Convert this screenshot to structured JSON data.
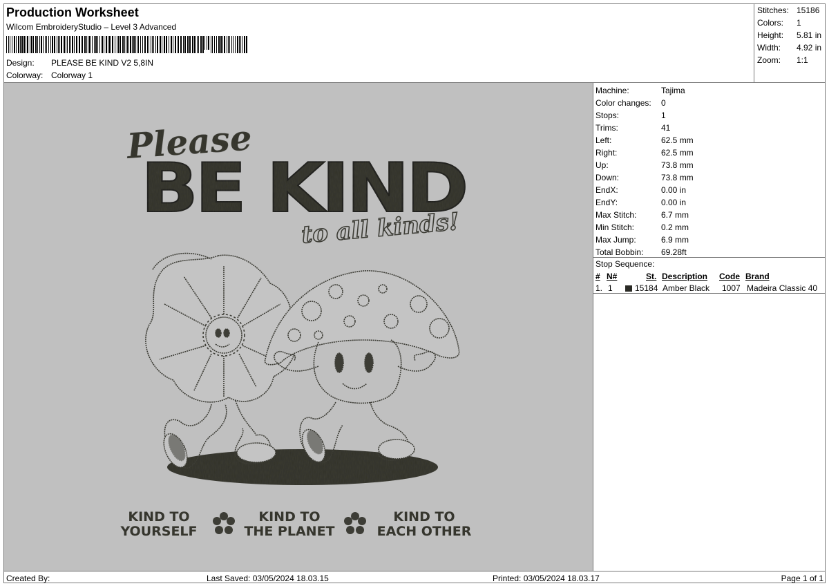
{
  "header": {
    "title": "Production Worksheet",
    "subtitle": "Wilcom EmbroideryStudio – Level 3 Advanced",
    "barcode_icon": "barcode",
    "design_label": "Design:",
    "design_value": "PLEASE BE KIND V2 5,8IN",
    "colorway_label": "Colorway:",
    "colorway_value": "Colorway 1"
  },
  "stats": {
    "stitches_label": "Stitches:",
    "stitches_value": "15186",
    "colors_label": "Colors:",
    "colors_value": "1",
    "height_label": "Height:",
    "height_value": "5.81 in",
    "width_label": "Width:",
    "width_value": "4.92 in",
    "zoom_label": "Zoom:",
    "zoom_value": "1:1"
  },
  "machine_info": [
    {
      "label": "Machine:",
      "value": "Tajima"
    },
    {
      "label": "Color changes:",
      "value": "0"
    },
    {
      "label": "Stops:",
      "value": "1"
    },
    {
      "label": "Trims:",
      "value": "41"
    },
    {
      "label": "Left:",
      "value": "62.5 mm"
    },
    {
      "label": "Right:",
      "value": "62.5 mm"
    },
    {
      "label": "Up:",
      "value": "73.8 mm"
    },
    {
      "label": "Down:",
      "value": "73.8 mm"
    },
    {
      "label": "EndX:",
      "value": "0.00 in"
    },
    {
      "label": "EndY:",
      "value": "0.00 in"
    },
    {
      "label": "Max Stitch:",
      "value": "6.7 mm"
    },
    {
      "label": "Min Stitch:",
      "value": "0.2 mm"
    },
    {
      "label": "Max Jump:",
      "value": "6.9 mm"
    },
    {
      "label": "Total Bobbin:",
      "value": "69.28ft"
    }
  ],
  "stop_sequence": {
    "title": "Stop Sequence:",
    "headers": {
      "num": "#",
      "n": "N#",
      "st": "St.",
      "description": "Description",
      "code": "Code",
      "brand": "Brand"
    },
    "rows": [
      {
        "num": "1.",
        "n": "1",
        "color": "#2a2a25",
        "st": "15184",
        "description": "Amber Black",
        "code": "1007",
        "brand": "Madeira Classic 40"
      }
    ]
  },
  "design": {
    "background": "#c0c0c0",
    "thread_color": "#3d3d36",
    "line1": "Please",
    "line2": "BE KIND",
    "line3": "to all kinds!",
    "caption1_a": "KIND TO",
    "caption1_b": "YOURSELF",
    "caption2_a": "KIND TO",
    "caption2_b": "THE PLANET",
    "caption3_a": "KIND TO",
    "caption3_b": "EACH OTHER"
  },
  "footer": {
    "created_by": "Created By:",
    "last_saved": "Last Saved: 03/05/2024 18.03.15",
    "printed": "Printed: 03/05/2024 18.03.17",
    "page": "Page 1 of 1"
  }
}
